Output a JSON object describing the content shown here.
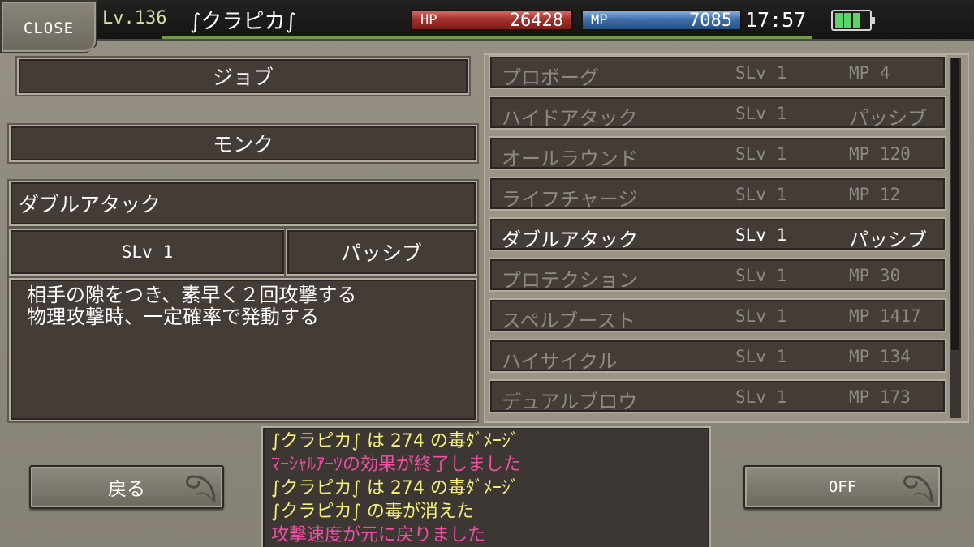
{
  "header": {
    "close_label": "CLOSE",
    "level": "Lv.136",
    "character_name": "∫クラピカ∫",
    "hp_label": "HP",
    "hp_value": "26428",
    "mp_label": "MP",
    "mp_value": "7085",
    "time": "17:57",
    "exp_progress": 1.0,
    "battery_icon": "battery-icon"
  },
  "job": {
    "title": "ジョブ",
    "class_name": "モンク"
  },
  "detail": {
    "skill_name": "ダブルアタック",
    "skill_level": "SLv 1",
    "skill_type": "パッシブ",
    "description_line1": "相手の隙をつき、素早く２回攻撃する",
    "description_line2": "物理攻撃時、一定確率で発動する"
  },
  "skills": [
    {
      "name": "プロボーグ",
      "slv": "SLv 1",
      "cost": "MP 4"
    },
    {
      "name": "ハイドアタック",
      "slv": "SLv 1",
      "cost": "パッシブ"
    },
    {
      "name": "オールラウンド",
      "slv": "SLv 1",
      "cost": "MP 120"
    },
    {
      "name": "ライフチャージ",
      "slv": "SLv 1",
      "cost": "MP 12"
    },
    {
      "name": "ダブルアタック",
      "slv": "SLv 1",
      "cost": "パッシブ"
    },
    {
      "name": "プロテクション",
      "slv": "SLv 1",
      "cost": "MP 30"
    },
    {
      "name": "スペルブースト",
      "slv": "SLv 1",
      "cost": "MP 1417"
    },
    {
      "name": "ハイサイクル",
      "slv": "SLv 1",
      "cost": "MP 134"
    },
    {
      "name": "デュアルブロウ",
      "slv": "SLv 1",
      "cost": "MP 173"
    }
  ],
  "log": [
    {
      "text": "∫クラピカ∫ は 274 の毒ﾀﾞﾒｰｼﾞ",
      "color": "#f4ef7e"
    },
    {
      "text": "ﾏｰｼｬﾙｱｰﾂの効果が終了しました",
      "color": "#f04fa3"
    },
    {
      "text": "∫クラピカ∫ は 274 の毒ﾀﾞﾒｰｼﾞ",
      "color": "#f4ef7e"
    },
    {
      "text": "∫クラピカ∫ の毒が消えた",
      "color": "#f4ef7e"
    },
    {
      "text": "攻撃速度が元に戻りました",
      "color": "#f04fa3"
    }
  ],
  "buttons": {
    "back_label": "戻る",
    "toggle_label": "OFF"
  }
}
